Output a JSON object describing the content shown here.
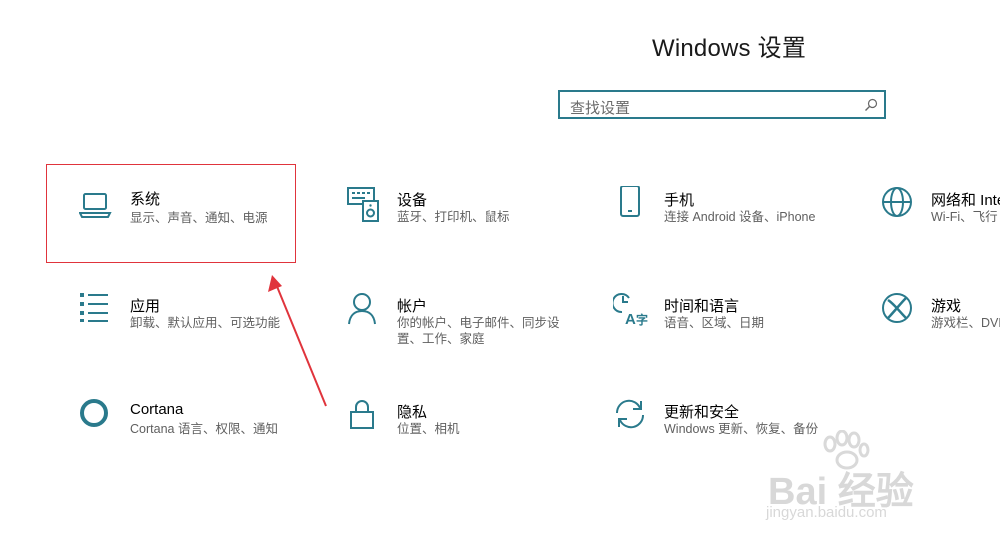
{
  "window": {
    "title": "Windows 设置"
  },
  "search": {
    "placeholder": "查找设置"
  },
  "tiles": [
    {
      "name": "系统",
      "desc": "显示、声音、通知、电源",
      "icon": "laptop-icon"
    },
    {
      "name": "设备",
      "desc": "蓝牙、打印机、鼠标",
      "icon": "keyboard-speaker-icon"
    },
    {
      "name": "手机",
      "desc": "连接 Android 设备、iPhone",
      "icon": "phone-icon"
    },
    {
      "name": "网络和 Inte",
      "desc": "Wi-Fi、飞行",
      "icon": "globe-icon"
    },
    {
      "name": "应用",
      "desc": "卸载、默认应用、可选功能",
      "icon": "apps-list-icon"
    },
    {
      "name": "帐户",
      "desc": "你的帐户、电子邮件、同步设置、工作、家庭",
      "icon": "person-icon"
    },
    {
      "name": "时间和语言",
      "desc": "语音、区域、日期",
      "icon": "time-language-icon"
    },
    {
      "name": "游戏",
      "desc": "游戏栏、DVR",
      "icon": "xbox-icon"
    },
    {
      "name": "Cortana",
      "desc": "Cortana 语言、权限、通知",
      "icon": "cortana-icon"
    },
    {
      "name": "隐私",
      "desc": "位置、相机",
      "icon": "lock-icon"
    },
    {
      "name": "更新和安全",
      "desc": "Windows 更新、恢复、备份",
      "icon": "sync-icon"
    }
  ],
  "watermark": {
    "text": "Bai 经验",
    "sub": "jingyan.baidu.com"
  },
  "colors": {
    "accent": "#2a7a8c",
    "highlight": "#e0343c"
  }
}
